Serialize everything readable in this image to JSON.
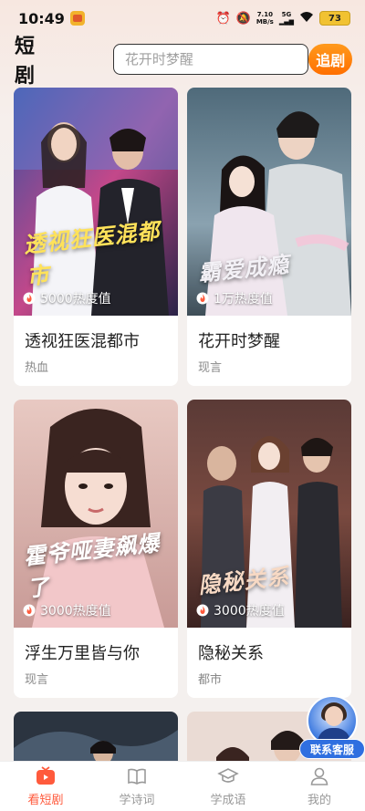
{
  "status_bar": {
    "time": "10:49",
    "net_speed_value": "7.10",
    "net_speed_unit": "MB/s",
    "network": "5G",
    "battery": "73"
  },
  "header": {
    "title": "短剧",
    "search_placeholder": "花开时梦醒",
    "follow_label": "追剧"
  },
  "dramas": [
    {
      "poster_title": "透视狂医混都市",
      "heat": "5000热度值",
      "title": "透视狂医混都市",
      "tag": "热血"
    },
    {
      "poster_title": "霸爱成瘾",
      "heat": "1万热度值",
      "title": "花开时梦醒",
      "tag": "现言"
    },
    {
      "poster_title": "霍爷哑妻飙爆了",
      "heat": "3000热度值",
      "title": "浮生万里皆与你",
      "tag": "现言"
    },
    {
      "poster_title": "隐秘关系",
      "heat": "3000热度值",
      "title": "隐秘关系",
      "tag": "都市"
    }
  ],
  "customer_service": {
    "label": "联系客服"
  },
  "bottom_nav": [
    {
      "label": "看短剧",
      "icon": "tv-icon",
      "active": true
    },
    {
      "label": "学诗词",
      "icon": "book-icon",
      "active": false
    },
    {
      "label": "学成语",
      "icon": "graduation-cap-icon",
      "active": false
    },
    {
      "label": "我的",
      "icon": "person-icon",
      "active": false
    }
  ],
  "colors": {
    "accent": "#ff5a3c",
    "follow_button": "#ff7a00",
    "service_blue": "#2f6fe0"
  }
}
